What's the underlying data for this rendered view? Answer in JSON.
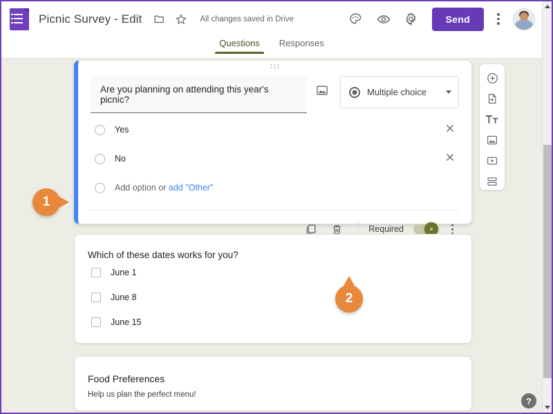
{
  "header": {
    "logo_icon": "google-forms-logo",
    "doc_title": "Picnic Survey - Edit",
    "folder_icon": "folder-icon",
    "star_icon": "star-icon",
    "save_status": "All changes saved in Drive",
    "theme_icon": "palette-icon",
    "preview_icon": "eye-icon",
    "settings_icon": "gear-icon",
    "send_label": "Send",
    "more_icon": "kebab-menu-icon",
    "avatar_label": "account-avatar"
  },
  "tabs": [
    {
      "label": "Questions",
      "active": true
    },
    {
      "label": "Responses",
      "active": false
    }
  ],
  "cards": [
    {
      "id": "card1",
      "active": true,
      "drag_handle": "drag-handle-dots",
      "question_text": "Are you planning on attending this year's picnic?",
      "image_icon": "add-image-icon",
      "question_type": "Multiple choice",
      "question_type_icon": "radio-filled-icon",
      "options": [
        {
          "label": "Yes",
          "remove_icon": "close-icon"
        },
        {
          "label": "No",
          "remove_icon": "close-icon"
        }
      ],
      "add_option_text": "Add option",
      "add_option_or": "or",
      "add_other_link": "add \"Other\"",
      "toolbar": {
        "duplicate_icon": "duplicate-icon",
        "delete_icon": "trash-icon",
        "required_label": "Required",
        "required_on": true,
        "more_icon": "kebab-menu-icon"
      }
    },
    {
      "id": "card2",
      "active": false,
      "question_text": "Which of these dates works for you?",
      "options": [
        {
          "label": "June 1"
        },
        {
          "label": "June 8"
        },
        {
          "label": "June 15"
        }
      ]
    },
    {
      "id": "card3",
      "active": false,
      "section_title": "Food Preferences",
      "section_description": "Help us plan the perfect menu!"
    }
  ],
  "palette": [
    {
      "icon": "add-question-icon",
      "glyph": "plus-circle"
    },
    {
      "icon": "import-questions-icon",
      "glyph": "import-doc"
    },
    {
      "icon": "add-title-icon",
      "glyph": "Tt"
    },
    {
      "icon": "add-image-icon",
      "glyph": "image"
    },
    {
      "icon": "add-video-icon",
      "glyph": "video"
    },
    {
      "icon": "add-section-icon",
      "glyph": "section"
    }
  ],
  "callouts": [
    {
      "number": "1"
    },
    {
      "number": "2"
    }
  ],
  "help": {
    "label": "?",
    "icon": "help-icon"
  },
  "scrollbar": {
    "up_icon": "scroll-up-arrow",
    "down_icon": "scroll-down-arrow"
  },
  "colors": {
    "brand_purple": "#673ab7",
    "accent_blue": "#4285f4",
    "callout_orange": "#e8883a",
    "toggle_olive": "#6b7229",
    "canvas_bg": "#edede6",
    "tab_underline": "#57642a"
  }
}
